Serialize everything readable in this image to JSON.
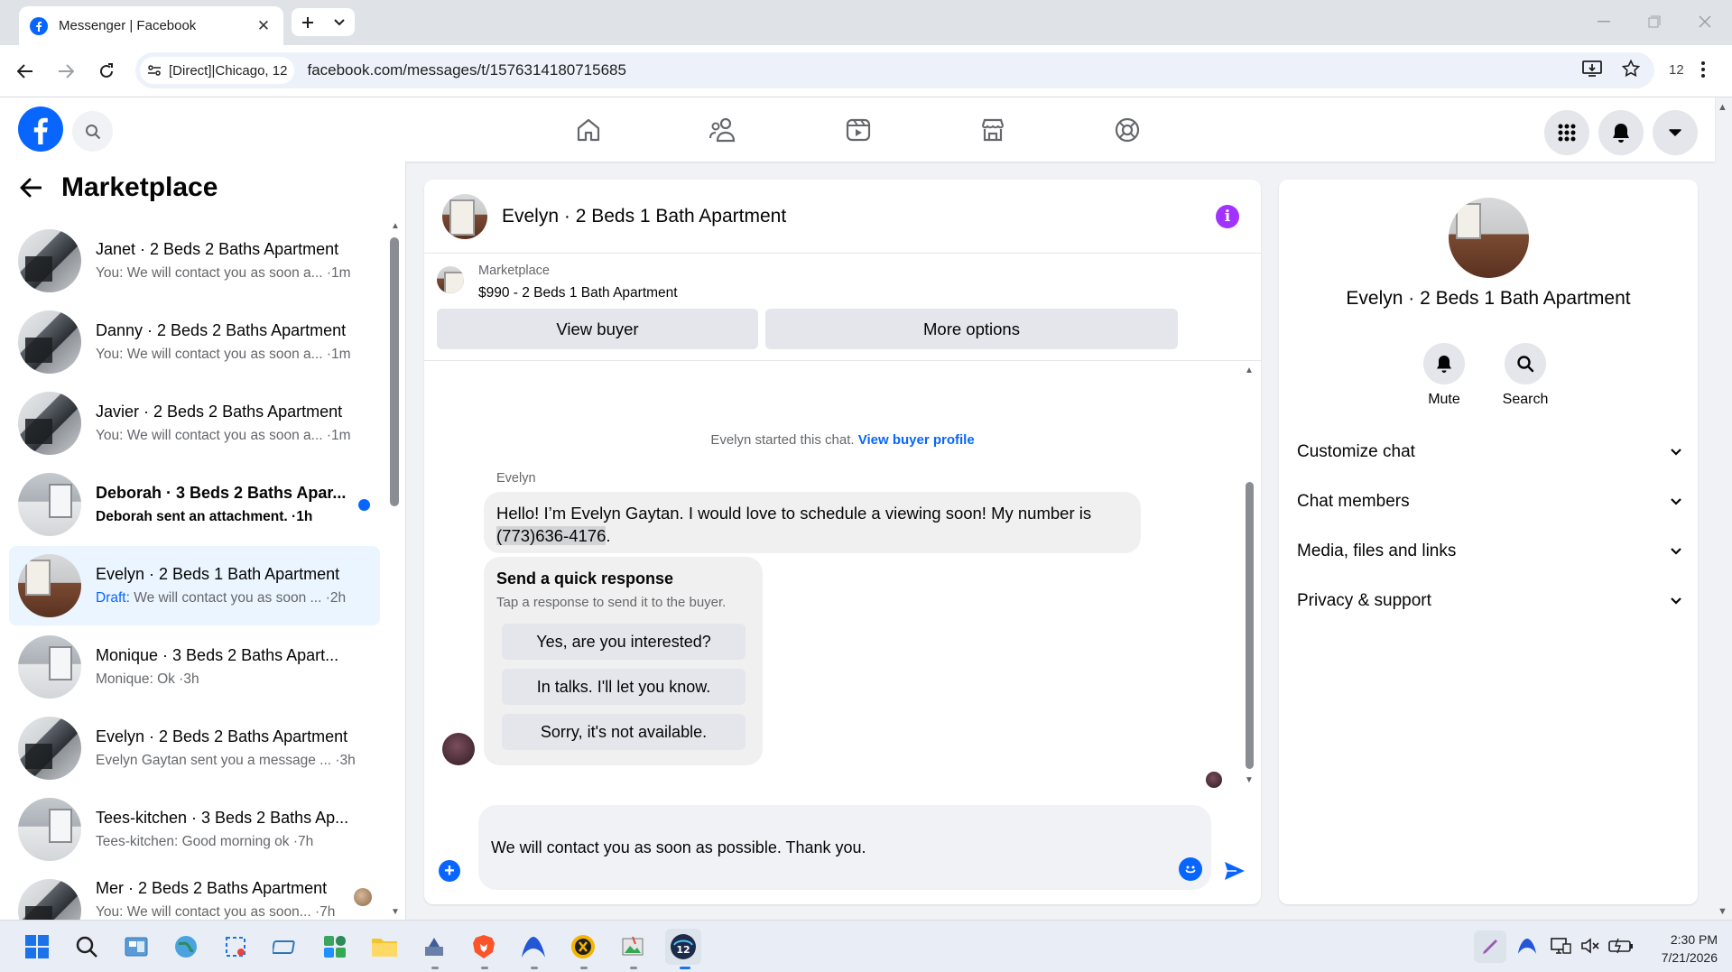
{
  "browser": {
    "tab_title": "Messenger | Facebook",
    "site_chip": "[Direct]|Chicago, 12",
    "url": "facebook.com/messages/t/1576314180715685",
    "profile_count": "12"
  },
  "sidebar": {
    "title": "Marketplace",
    "chats": [
      {
        "title": "Janet · 2 Beds 2 Baths Apartment",
        "subtitle": "You: We will contact you as soon a... ·1m",
        "avatar": "kitchen",
        "unread": false
      },
      {
        "title": "Danny · 2 Beds 2 Baths Apartment",
        "subtitle": "You: We will contact you as soon a... ·1m",
        "avatar": "kitchen",
        "unread": false
      },
      {
        "title": "Javier · 2 Beds 2 Baths Apartment",
        "subtitle": "You: We will contact you as soon a... ·1m",
        "avatar": "kitchen",
        "unread": false
      },
      {
        "title": "Deborah · 3 Beds 2 Baths Apar...",
        "subtitle": "Deborah sent an attachment. ·1h",
        "avatar": "room",
        "unread": true
      },
      {
        "title": "Evelyn · 2 Beds 1 Bath Apartment",
        "draft_label": "Draft:",
        "subtitle": "We will contact you as soon ... ·2h",
        "avatar": "evelyn",
        "unread": false,
        "active": true
      },
      {
        "title": "Monique · 3 Beds 2 Baths Apart...",
        "subtitle": "Monique: Ok ·3h",
        "avatar": "room",
        "unread": false
      },
      {
        "title": "Evelyn · 2 Beds 2 Baths Apartment",
        "subtitle": "Evelyn Gaytan sent you a message ... ·3h",
        "avatar": "kitchen",
        "unread": false
      },
      {
        "title": "Tees-kitchen · 3 Beds 2 Baths Ap...",
        "subtitle": "Tees-kitchen: Good morning ok ·7h",
        "avatar": "room",
        "unread": false
      },
      {
        "title": "Mer · 2 Beds 2 Baths Apartment",
        "subtitle": "You: We will contact you as soon... ·7h",
        "avatar": "kitchen",
        "unread": false
      }
    ]
  },
  "conversation": {
    "title": "Evelyn · 2 Beds 1 Bath Apartment",
    "marketplace_label": "Marketplace",
    "listing": "$990 - 2 Beds 1 Bath Apartment",
    "view_buyer": "View buyer",
    "more_options": "More options",
    "started_text": "Evelyn started this chat.",
    "view_profile": "View buyer profile",
    "sender": "Evelyn",
    "message_part1": "Hello! I’m Evelyn Gaytan. I would love to schedule a viewing soon! My number is",
    "message_phone": "(773)636-4176",
    "message_end": ".",
    "quick_title": "Send a quick response",
    "quick_sub": "Tap a response to send it to the buyer.",
    "quick_replies": [
      "Yes, are you interested?",
      "In talks. I'll let you know.",
      "Sorry, it's not available."
    ],
    "composer_text": "We will contact you as soon as possible. Thank you."
  },
  "info_panel": {
    "name": "Evelyn · 2 Beds 1 Bath Apartment",
    "mute": "Mute",
    "search": "Search",
    "rows": [
      "Customize chat",
      "Chat members",
      "Media, files and links",
      "Privacy & support"
    ]
  },
  "taskbar": {
    "time": "2:30 PM",
    "date": "7/21/2026"
  },
  "colors": {
    "accent": "#0866ff",
    "info": "#a033ff",
    "active_chat": "#ebf5ff"
  }
}
